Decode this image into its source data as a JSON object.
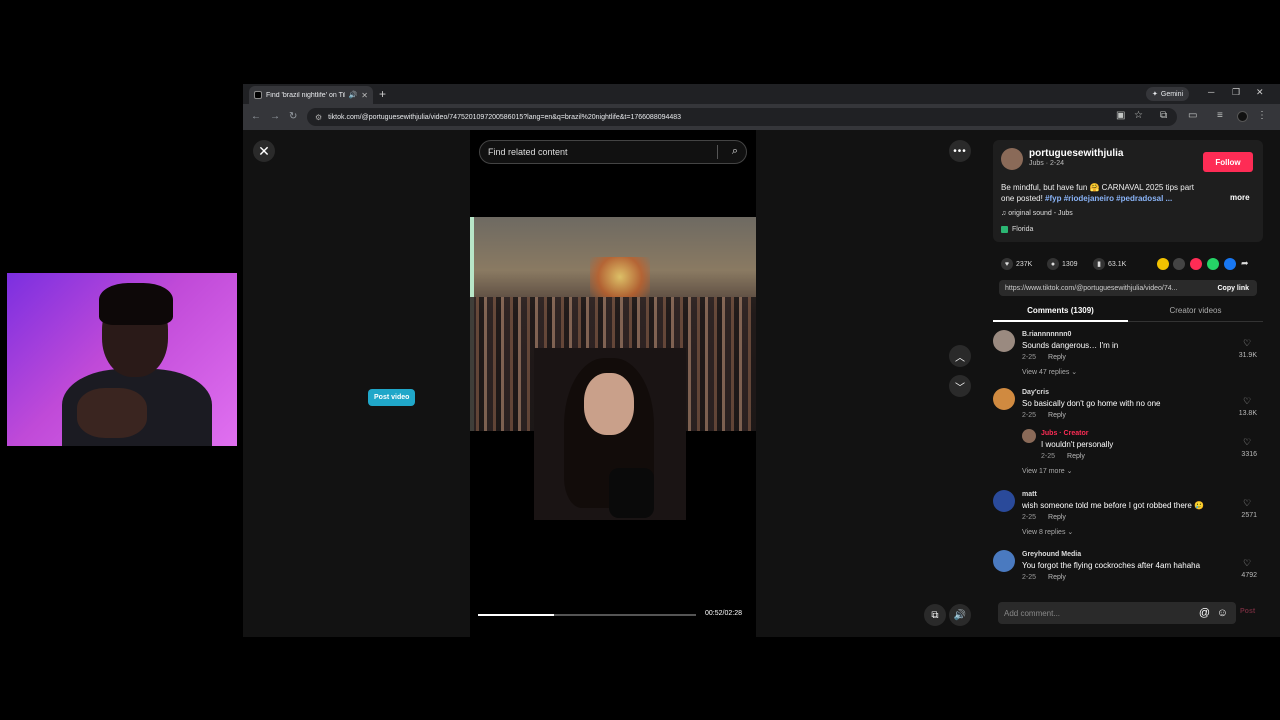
{
  "browser": {
    "tab_title": "Find 'brazil nightlife' on Tik",
    "new_tab": "+",
    "gemini_label": "Gemini",
    "url": "tiktok.com/@portuguesewithjulia/video/7475201097200586015?lang=en&q=brazil%20nightlife&t=1766088094483"
  },
  "page": {
    "close": "✕",
    "post_video": "Post video",
    "search_placeholder": "Find related content",
    "timecode": "00:52/02:28",
    "progress_fraction": 0.35
  },
  "post": {
    "username": "portuguesewithjulia",
    "subline": "Jubs · 2-24",
    "follow": "Follow",
    "desc_text": "Be mindful, but have fun 🤗 CARNAVAL 2025 tips part one posted! ",
    "desc_tags": "#fyp #riodejaneiro #pedradosal ...",
    "more": "more",
    "sound": "♫  original sound - Jubs",
    "location": "Florida",
    "likes": "237K",
    "comments_count": "1309",
    "saves": "63.1K",
    "link": "https://www.tiktok.com/@portuguesewithjulia/video/74...",
    "copy_link": "Copy link"
  },
  "tabs": {
    "comments": "Comments (1309)",
    "creator": "Creator videos"
  },
  "comments": [
    {
      "name": "B.riannnnnnn0",
      "text": "Sounds dangerous… I'm in",
      "date": "2-25",
      "reply": "Reply",
      "likes": "31.9K",
      "view": "View 47 replies ⌄"
    },
    {
      "name": "Day'cris",
      "text": "So basically don't go home with no one",
      "date": "2-25",
      "reply": "Reply",
      "likes": "13.8K"
    },
    {
      "name": "Jubs · Creator",
      "text": "I wouldn't personally",
      "date": "2-25",
      "reply": "Reply",
      "likes": "3316",
      "view": "View 17 more ⌄"
    },
    {
      "name": "matt",
      "text": "wish someone told me before I got robbed there 🥲",
      "date": "2-25",
      "reply": "Reply",
      "likes": "2571",
      "view": "View 8 replies ⌄"
    },
    {
      "name": "Greyhound Media",
      "text": "You forgot the flying cockroches after 4am hahaha",
      "date": "2-25",
      "reply": "Reply",
      "likes": "4792"
    }
  ],
  "comment_bar": {
    "placeholder": "Add comment...",
    "post": "Post"
  },
  "colors": {
    "follow": "#fe2c55",
    "post_video": "#20a7c9",
    "hashtag": "#8ab4f8"
  }
}
